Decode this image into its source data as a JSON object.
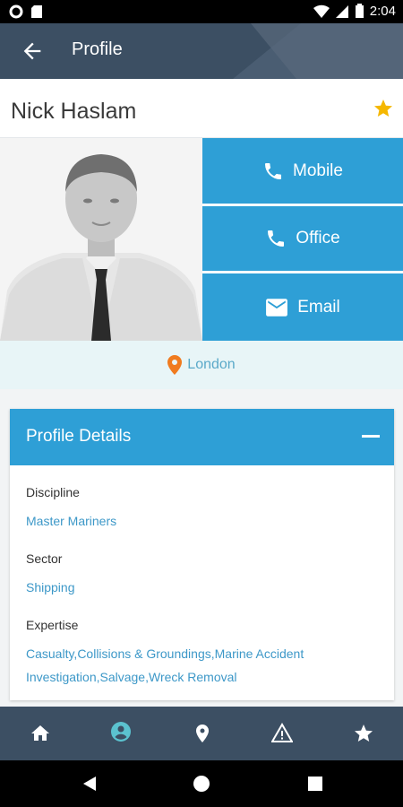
{
  "status": {
    "time": "2:04"
  },
  "appbar": {
    "title": "Profile",
    "back_icon": "arrow-left-icon"
  },
  "profile": {
    "name": "Nick Haslam",
    "favorite_icon": "star-icon",
    "location": "London",
    "photo": "person-photo"
  },
  "contact": {
    "mobile_label": "Mobile",
    "office_label": "Office",
    "email_label": "Email"
  },
  "details": {
    "header": "Profile Details",
    "fields": [
      {
        "label": "Discipline",
        "value": "Master Mariners"
      },
      {
        "label": "Sector",
        "value": "Shipping"
      },
      {
        "label": "Expertise",
        "value": "Casualty,Collisions & Groundings,Marine Accident Investigation,Salvage,Wreck Removal"
      }
    ]
  },
  "nav": {
    "items": [
      "home-icon",
      "account-icon",
      "location-icon",
      "warning-icon",
      "star-icon"
    ],
    "active": "account-icon"
  },
  "colors": {
    "appbar": "#3c4f63",
    "accent": "#2e9fd6",
    "star": "#f5b700",
    "location_pin": "#f07b1f",
    "link_text": "#3d98c8"
  }
}
